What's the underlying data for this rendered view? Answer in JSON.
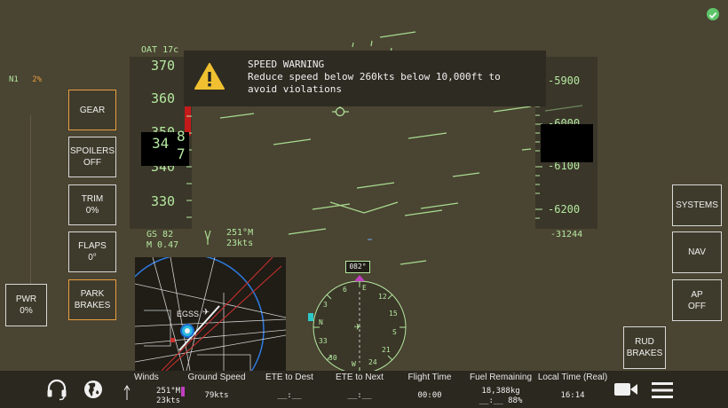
{
  "status": {
    "check_color": "#5ec46a"
  },
  "engine": {
    "n1_label": "N1",
    "n1_value": "2%"
  },
  "speed_tape": {
    "oat": "OAT 17c",
    "ticks": [
      "370",
      "360",
      "350",
      "340",
      "330"
    ],
    "current_a": "34",
    "current_b": "8",
    "current_c": "7",
    "gs": "GS 82",
    "mach": "M 0.47"
  },
  "alt_tape": {
    "ticks": [
      "-5900",
      "-6000",
      "-6100",
      "-6200"
    ],
    "baro": "-31244"
  },
  "warning": {
    "title": "SPEED WARNING",
    "line1": "Reduce speed below 260kts below 10,000ft to",
    "line2": "avoid violations"
  },
  "wind_hud": {
    "dir": "251°M",
    "speed": "23kts"
  },
  "left_buttons": {
    "gear": "GEAR",
    "spoilers": "SPOILERS",
    "spoilers_state": "OFF",
    "trim": "TRIM",
    "trim_value": "0%",
    "flaps": "FLAPS",
    "flaps_value": "0°",
    "park": "PARK",
    "brakes": "BRAKES",
    "pwr": "PWR",
    "pwr_value": "0%"
  },
  "right_buttons": {
    "systems": "SYSTEMS",
    "nav": "NAV",
    "ap": "AP",
    "ap_state": "OFF",
    "rud": "RUD",
    "rud_brakes": "BRAKES"
  },
  "map": {
    "airport": "EGSS"
  },
  "compass": {
    "heading": "082°",
    "labels": [
      "N",
      "3",
      "6",
      "E",
      "12",
      "15",
      "S",
      "21",
      "24",
      "W",
      "30",
      "33"
    ]
  },
  "bottom": {
    "winds_label": "Winds",
    "winds_dir": "251°M",
    "winds_speed": "23kts",
    "gs_label": "Ground Speed",
    "gs_value": "79kts",
    "ete_dest_label": "ETE to Dest",
    "ete_dest_value": "__:__",
    "ete_next_label": "ETE to Next",
    "ete_next_value": "__:__",
    "flight_time_label": "Flight Time",
    "flight_time_value": "00:00",
    "fuel_label": "Fuel Remaining",
    "fuel_value": "18,388kg",
    "fuel_time": "__:__",
    "fuel_pct": "88%",
    "local_time_label": "Local Time (Real)",
    "local_time_value": "16:14"
  }
}
